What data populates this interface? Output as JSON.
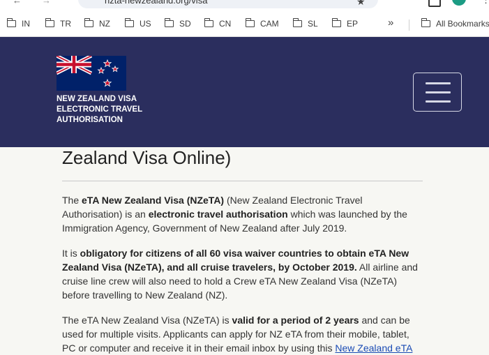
{
  "browser": {
    "url": "nzta-newzealand.org/visa",
    "bookmarks": [
      "IN",
      "TR",
      "NZ",
      "US",
      "SD",
      "CN",
      "CAM",
      "SL",
      "EP"
    ],
    "more_label": "»",
    "all_bookmarks_label": "All Bookmarks"
  },
  "header": {
    "brand_lines": [
      "NEW ZEALAND VISA",
      "ELECTRONIC TRAVEL",
      "AUTHORISATION"
    ],
    "menu_icon": "hamburger-icon",
    "bg_color": "#2b2e5e"
  },
  "content": {
    "heading": "Zealand Visa Online)",
    "p1": {
      "t1": "The ",
      "b1": "eTA New Zealand Visa (NZeTA)",
      "t2": " (New Zealand Electronic Travel Authorisation) is an ",
      "b2": "electronic travel authorisation",
      "t3": " which was launched by the Immigration Agency, Government of New Zealand after July 2019."
    },
    "p2": {
      "t1": "It is ",
      "b1": "obligatory for citizens of all 60 visa waiver countries to obtain eTA New Zealand Visa (NZeTA), and all cruise travelers, by October 2019.",
      "t2": " All airline and cruise line crew will also need to hold a Crew eTA New Zealand Visa (NZeTA) before travelling to New Zealand (NZ)."
    },
    "p3": {
      "t1": "The eTA New Zealand Visa (NZeTA) is ",
      "b1": "valid for a period of 2 years",
      "t2": " and can be used for multiple visits. Applicants can apply for NZ eTA from their mobile, tablet, PC or computer and receive it in their email inbox by using this ",
      "link": "New Zealand eTA"
    }
  }
}
